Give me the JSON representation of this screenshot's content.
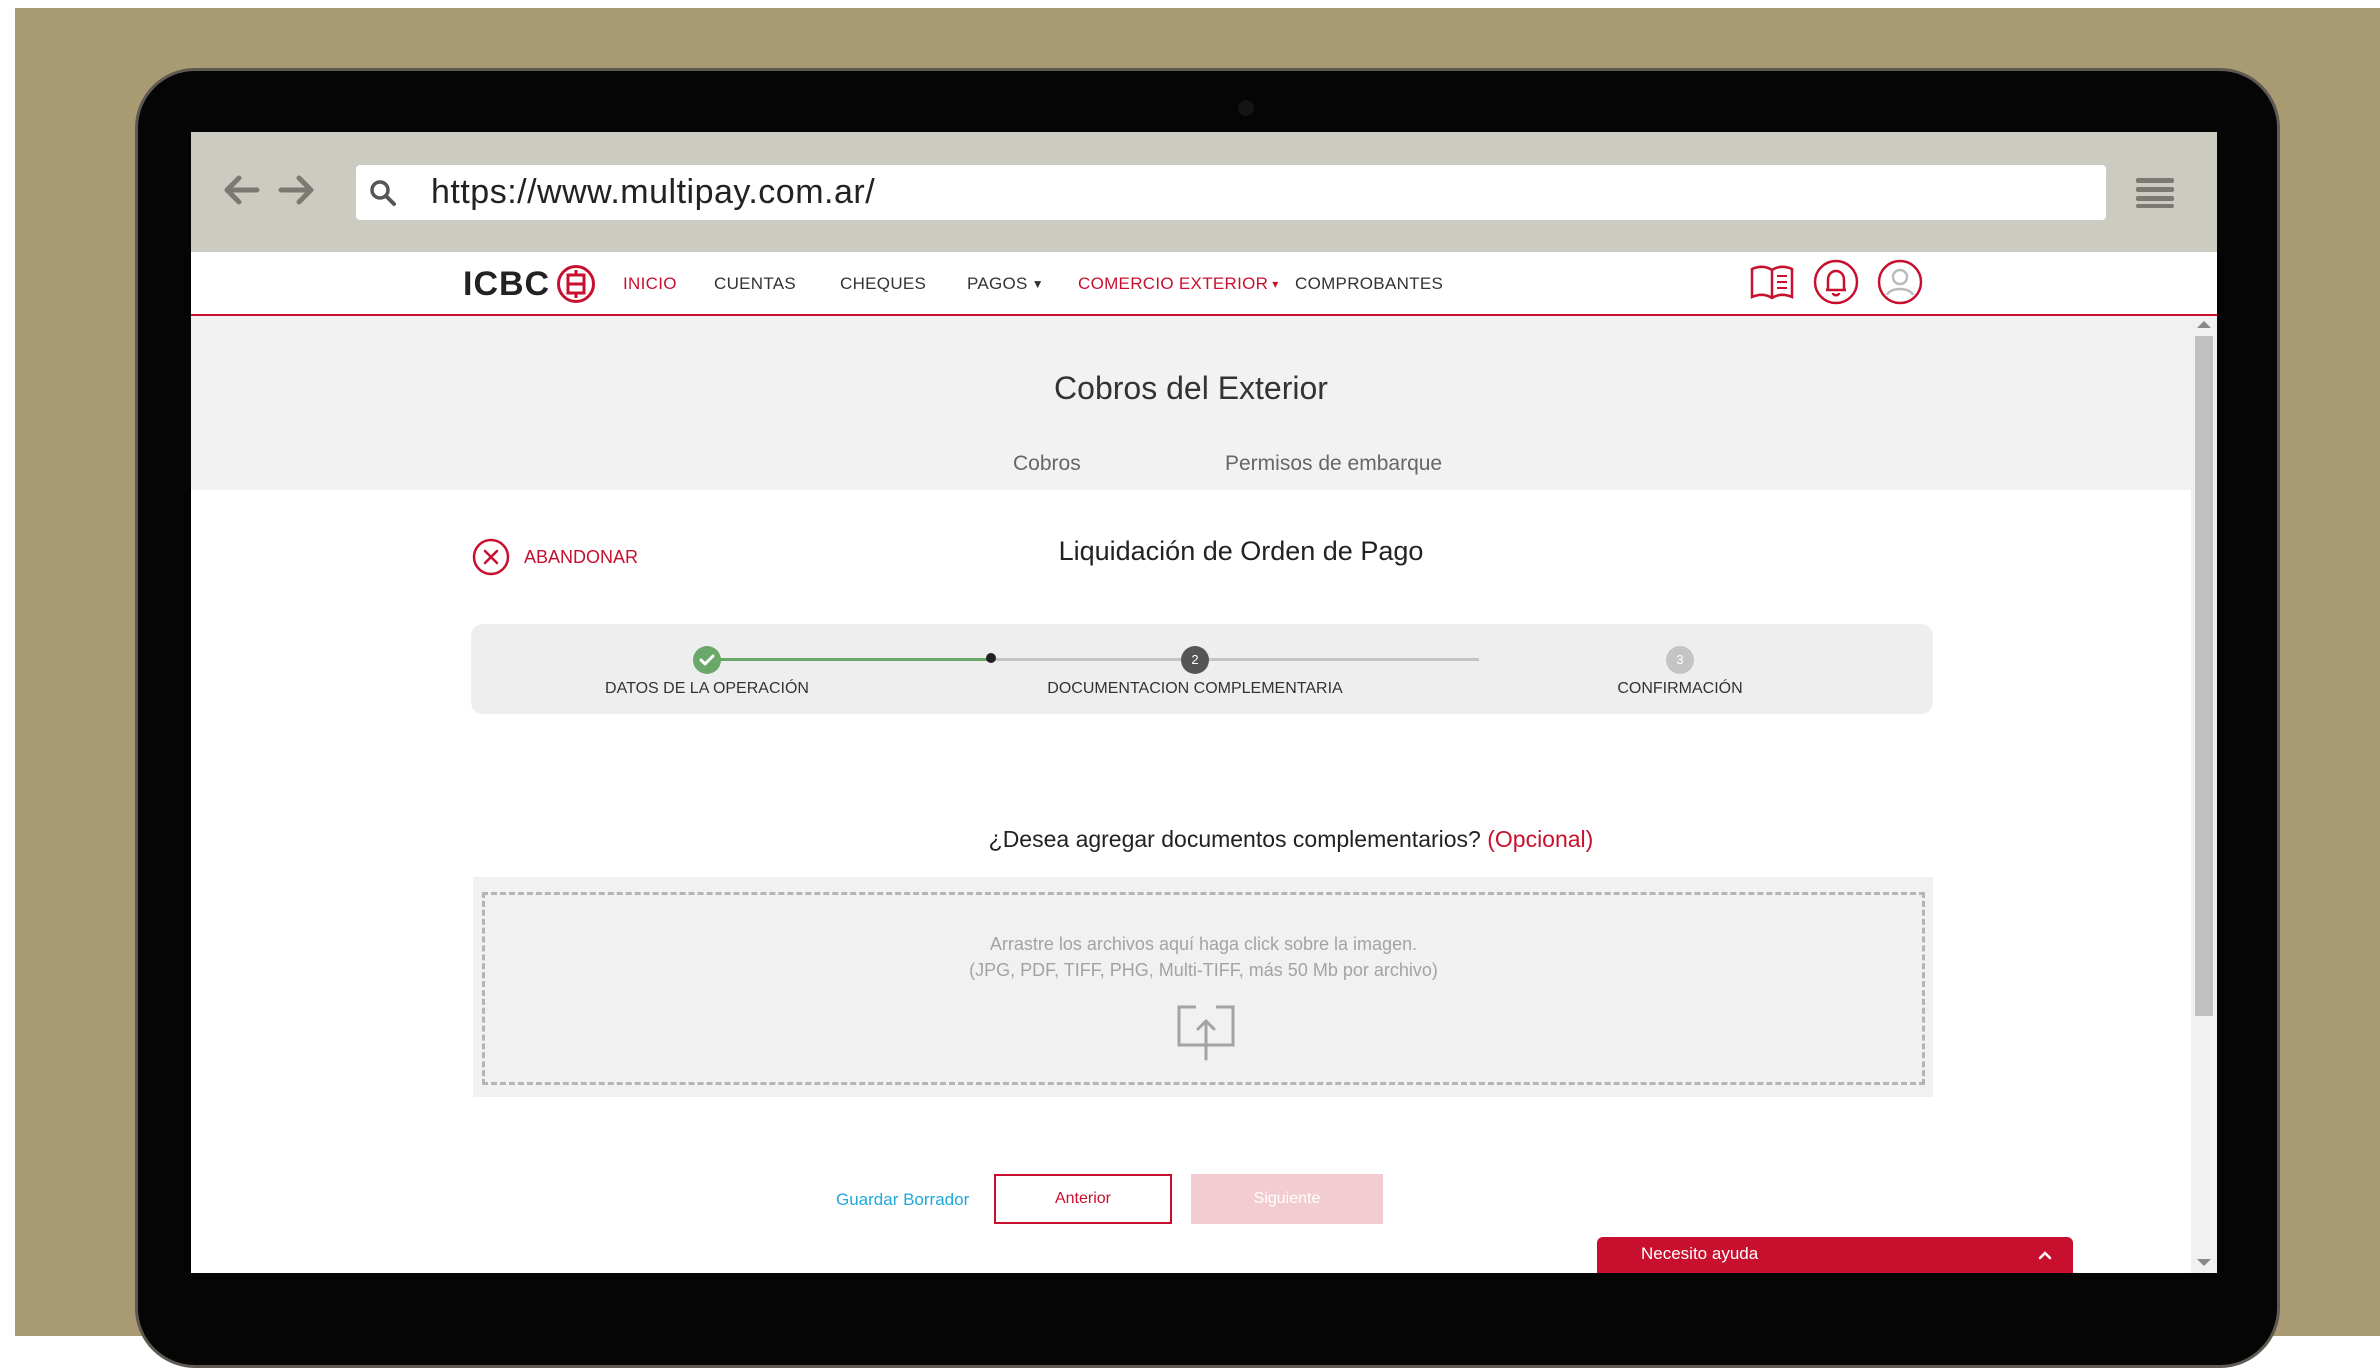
{
  "browser": {
    "url": "https://www.multipay.com.ar/"
  },
  "site_nav": {
    "logo_text": "ICBC",
    "items": [
      {
        "label": "INICIO",
        "active": true
      },
      {
        "label": "CUENTAS"
      },
      {
        "label": "CHEQUES"
      },
      {
        "label": "PAGOS",
        "dropdown": true
      },
      {
        "label": "COMERCIO EXTERIOR",
        "dropdown": true,
        "active": true
      },
      {
        "label": "COMPROBANTES"
      }
    ],
    "icons": [
      "book-icon",
      "bell-icon",
      "user-icon"
    ]
  },
  "page": {
    "title": "Cobros del Exterior",
    "tabs": [
      "Cobros",
      "Permisos de embarque"
    ],
    "abandon_label": "ABANDONAR",
    "form_title": "Liquidación de Orden de Pago"
  },
  "stepper": {
    "steps": [
      {
        "label": "DATOS DE LA OPERACIÓN",
        "status": "done"
      },
      {
        "label": "DOCUMENTACION COMPLEMENTARIA",
        "number": "2",
        "status": "current"
      },
      {
        "label": "CONFIRMACIÓN",
        "number": "3",
        "status": "pending"
      }
    ]
  },
  "upload": {
    "question": "¿Desea agregar documentos complementarios?",
    "optional": "(Opcional)",
    "hint_line1": "Arrastre los archivos aquí haga click sobre la imagen.",
    "hint_line2": "(JPG, PDF, TIFF, PHG, Multi-TIFF, más 50 Mb por archivo)",
    "icon": "upload-icon"
  },
  "actions": {
    "save_draft": "Guardar Borrador",
    "previous": "Anterior",
    "next": "Siguiente"
  },
  "help_widget": {
    "label": "Necesito ayuda"
  },
  "colors": {
    "brand_red": "#c8102e",
    "success_green": "#6aa86a",
    "link_blue": "#1fa9d9",
    "backdrop": "#a89a72"
  }
}
